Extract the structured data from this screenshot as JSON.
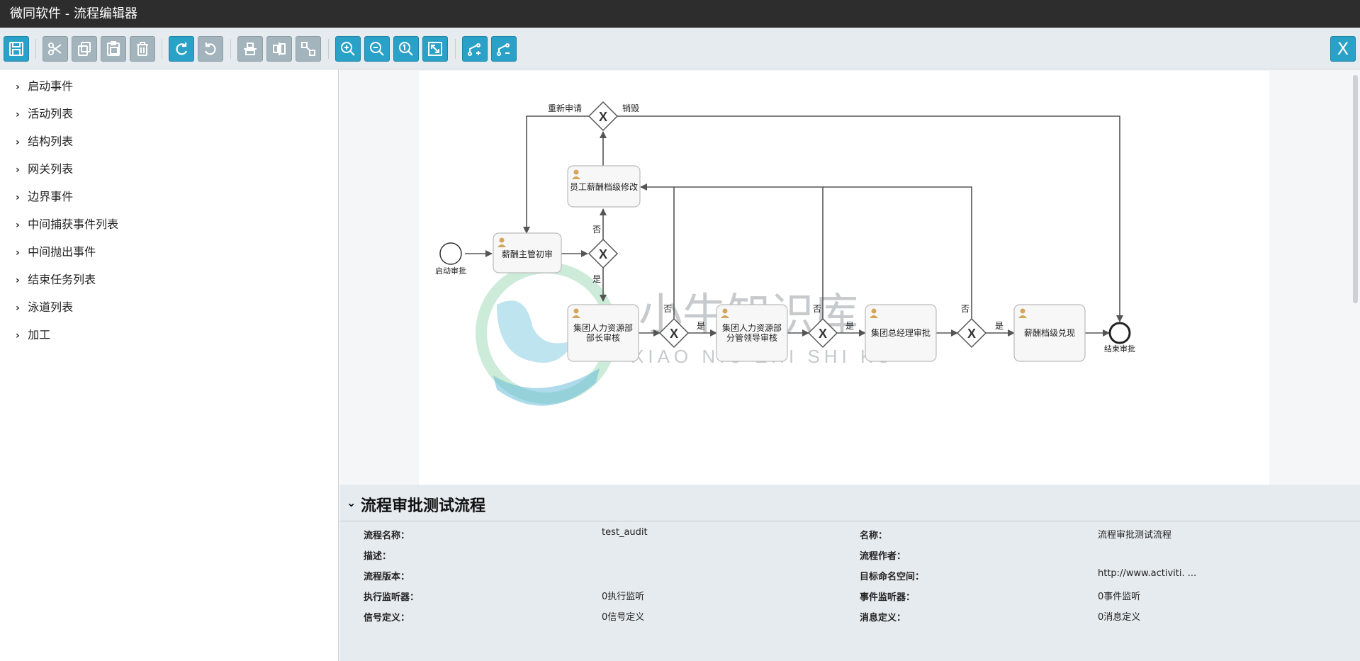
{
  "window": {
    "title": "微同软件 - 流程编辑器"
  },
  "toolbar": {
    "buttons": [
      {
        "name": "save-button",
        "icon": "save-icon",
        "enabled": true
      },
      {
        "name": "cut-button",
        "icon": "scissors-icon",
        "enabled": false
      },
      {
        "name": "copy-button",
        "icon": "copy-icon",
        "enabled": false
      },
      {
        "name": "paste-button",
        "icon": "paste-icon",
        "enabled": false
      },
      {
        "name": "delete-button",
        "icon": "trash-icon",
        "enabled": false
      },
      {
        "name": "redo-button",
        "icon": "redo-icon",
        "enabled": true
      },
      {
        "name": "undo-button",
        "icon": "undo-icon",
        "enabled": false
      },
      {
        "name": "align-horizontal-button",
        "icon": "align-horizontal-icon",
        "enabled": false
      },
      {
        "name": "align-vertical-button",
        "icon": "align-vertical-icon",
        "enabled": false
      },
      {
        "name": "same-size-button",
        "icon": "same-size-icon",
        "enabled": false
      },
      {
        "name": "zoom-in-button",
        "icon": "zoom-in-icon",
        "enabled": true
      },
      {
        "name": "zoom-out-button",
        "icon": "zoom-out-icon",
        "enabled": true
      },
      {
        "name": "zoom-actual-button",
        "icon": "zoom-actual-icon",
        "enabled": true
      },
      {
        "name": "zoom-fit-button",
        "icon": "zoom-fit-icon",
        "enabled": true
      },
      {
        "name": "add-bendpoint-button",
        "icon": "add-bendpoint-icon",
        "enabled": true
      },
      {
        "name": "remove-bendpoint-button",
        "icon": "remove-bendpoint-icon",
        "enabled": true
      }
    ],
    "close_label": "X"
  },
  "sidebar": {
    "items": [
      {
        "label": "启动事件"
      },
      {
        "label": "活动列表"
      },
      {
        "label": "结构列表"
      },
      {
        "label": "网关列表"
      },
      {
        "label": "边界事件"
      },
      {
        "label": "中间捕获事件列表"
      },
      {
        "label": "中间抛出事件"
      },
      {
        "label": "结束任务列表"
      },
      {
        "label": "泳道列表"
      },
      {
        "label": "加工"
      }
    ]
  },
  "diagram": {
    "start_event": "启动审批",
    "end_event": "结束审批",
    "tasks": {
      "manager_review": "薪酬主管初审",
      "employee_modify": "员工薪酬档级修改",
      "hr_head_review_l1": "集团人力资源部",
      "hr_head_review_l2": "部长审核",
      "hr_vp_review_l1": "集团人力资源部",
      "hr_vp_review_l2": "分管领导审核",
      "gm_review": "集团总经理审批",
      "payout": "薪酬档级兑现"
    },
    "gateway_marker": "X",
    "flow_labels": {
      "resubmit": "重新申请",
      "destroy": "销毁",
      "yes": "是",
      "no": "否"
    },
    "watermark": {
      "cn": "小牛知识库",
      "en": "XIAO NIU ZHI SHI KU"
    }
  },
  "properties": {
    "title": "流程审批测试流程",
    "left": [
      {
        "label": "流程名称：",
        "value": "test_audit"
      },
      {
        "label": "描述：",
        "value": ""
      },
      {
        "label": "流程版本：",
        "value": ""
      },
      {
        "label": "执行监听器：",
        "value": "0执行监听"
      },
      {
        "label": "信号定义：",
        "value": "0信号定义"
      }
    ],
    "right": [
      {
        "label": "名称：",
        "value": "流程审批测试流程"
      },
      {
        "label": "流程作者：",
        "value": ""
      },
      {
        "label": "目标命名空间：",
        "value": "http://www.activiti. ..."
      },
      {
        "label": "事件监听器：",
        "value": "0事件监听"
      },
      {
        "label": "消息定义：",
        "value": "0消息定义"
      }
    ]
  },
  "colors": {
    "accent": "#2aa2c8",
    "disabled": "#a3b4bc",
    "titlebar": "#2d2d2d",
    "panel": "#e6ebef"
  }
}
